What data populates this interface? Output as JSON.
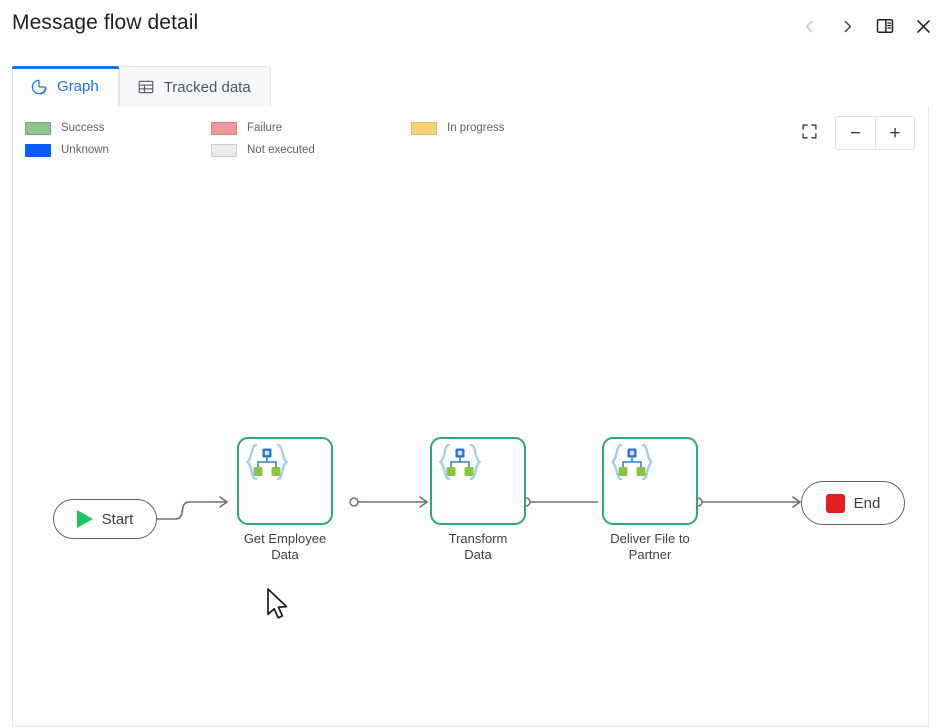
{
  "header": {
    "title": "Message flow detail",
    "actions": [
      {
        "name": "previous-button",
        "icon": "chevron-left-icon",
        "label": "Previous",
        "disabled": true
      },
      {
        "name": "next-button",
        "icon": "chevron-right-icon",
        "label": "Next",
        "disabled": false
      },
      {
        "name": "toggle-panel-button",
        "icon": "split-panel-icon",
        "label": "Toggle side panel",
        "disabled": false
      },
      {
        "name": "close-button",
        "icon": "close-icon",
        "label": "Close",
        "disabled": false
      }
    ]
  },
  "tabs": [
    {
      "label": "Graph",
      "icon": "pie-chart-icon",
      "active": true
    },
    {
      "label": "Tracked data",
      "icon": "table-icon",
      "active": false
    }
  ],
  "legend": {
    "items": [
      {
        "label": "Success",
        "color": "#8fc48d",
        "border": "#6fa96d"
      },
      {
        "label": "Failure",
        "color": "#ef9a9a",
        "border": "#d98080"
      },
      {
        "label": "In progress",
        "color": "#f5d176",
        "border": "#dfb959"
      },
      {
        "label": "Unknown",
        "color": "#0b5cf6",
        "border": "#0b5cf6"
      },
      {
        "label": "Not executed",
        "color": "#e9ebee",
        "border": "#c8ccd2"
      }
    ]
  },
  "zoom_controls": {
    "fit_label": "Fit to screen",
    "zoom_out_label": "−",
    "zoom_in_label": "+"
  },
  "flow": {
    "start": {
      "label": "Start",
      "icon": "play-icon",
      "color": "#21c45d"
    },
    "end": {
      "label": "End",
      "icon": "stop-icon",
      "color": "#e02020"
    },
    "nodes": [
      {
        "label_line1": "Get Employee",
        "label_line2": "Data",
        "icon": "data-mapping-icon",
        "status": "Success",
        "border_color": "#2faa70"
      },
      {
        "label_line1": "Transform",
        "label_line2": "Data",
        "icon": "data-mapping-icon",
        "status": "Success",
        "border_color": "#2faa70"
      },
      {
        "label_line1": "Deliver File to",
        "label_line2": "Partner",
        "icon": "data-mapping-icon",
        "status": "Success",
        "border_color": "#2faa70"
      }
    ]
  }
}
